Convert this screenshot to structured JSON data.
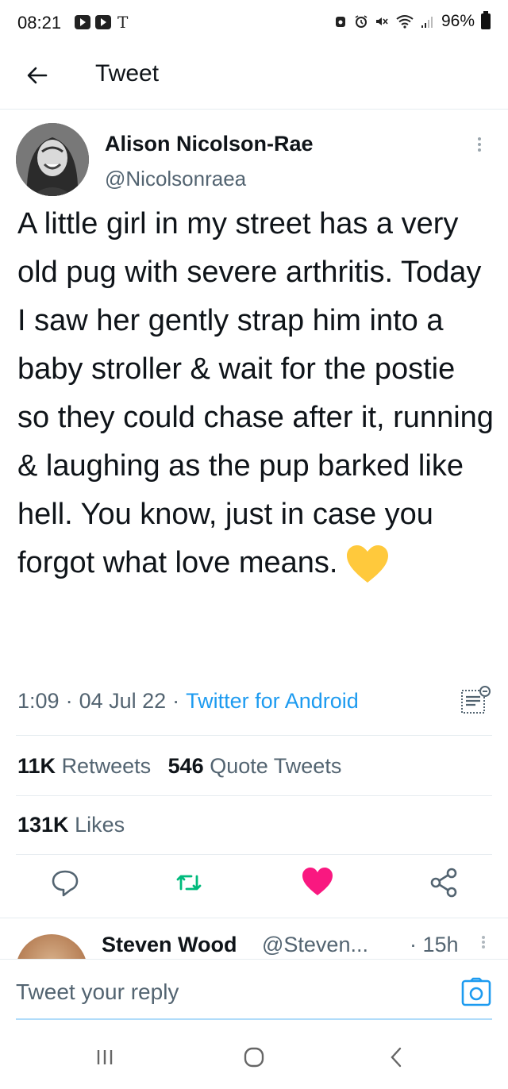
{
  "status_bar": {
    "time": "08:21",
    "carrier_glyph": "T",
    "battery": "96%"
  },
  "header": {
    "title": "Tweet",
    "back_icon": "arrow-left-icon"
  },
  "tweet": {
    "author_name": "Alison Nicolson-Rae",
    "author_handle": "@Nicolsonraea",
    "text": "A little girl in my street has a very old pug with severe arthritis. Today I saw her gently strap him into a baby stroller & wait for the postie so they could chase after it, running & laughing as the pup barked like hell. You know, just in case you forgot what love means.",
    "emoji": "yellow-heart-icon",
    "time": "1:09",
    "date": "04 Jul 22",
    "separator": "·",
    "source": "Twitter for Android"
  },
  "stats": {
    "retweets_count": "11K",
    "retweets_label": "Retweets",
    "quotes_count": "546",
    "quotes_label": "Quote Tweets",
    "likes_count": "131K",
    "likes_label": "Likes"
  },
  "actions": {
    "reply_icon": "reply-icon",
    "retweet_icon": "retweet-icon",
    "like_icon": "heart-icon",
    "share_icon": "share-icon",
    "like_color": "#f91880",
    "retweet_color": "#00ba7c"
  },
  "reply_preview": {
    "name": "Steven Wood",
    "handle": "@Steven...",
    "time": "· 15h"
  },
  "composer": {
    "placeholder": "Tweet your reply"
  },
  "colors": {
    "accent": "#1d9bf0",
    "text": "#0f1419",
    "secondary": "#536471"
  }
}
